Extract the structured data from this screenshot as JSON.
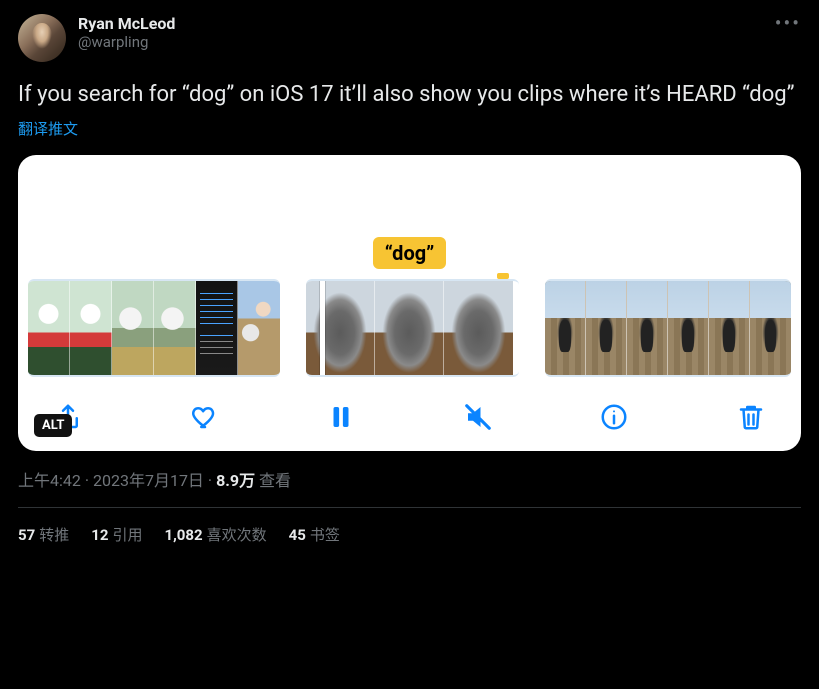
{
  "author": {
    "display_name": "Ryan McLeod",
    "handle": "@warpling"
  },
  "body": "If you search for “dog” on iOS 17 it’ll also show you clips where it’s HEARD “dog”",
  "translate_label": "翻译推文",
  "media": {
    "caption_bubble": "“dog”",
    "alt_badge": "ALT"
  },
  "meta": {
    "time": "上午4:42",
    "separator1": " · ",
    "date": "2023年7月17日",
    "separator2": " · ",
    "views_num": "8.9万",
    "views_label": " 查看"
  },
  "stats": {
    "retweets_num": "57",
    "retweets_label": "转推",
    "quotes_num": "12",
    "quotes_label": "引用",
    "likes_num": "1,082",
    "likes_label": "喜欢次数",
    "bookmarks_num": "45",
    "bookmarks_label": "书签"
  }
}
